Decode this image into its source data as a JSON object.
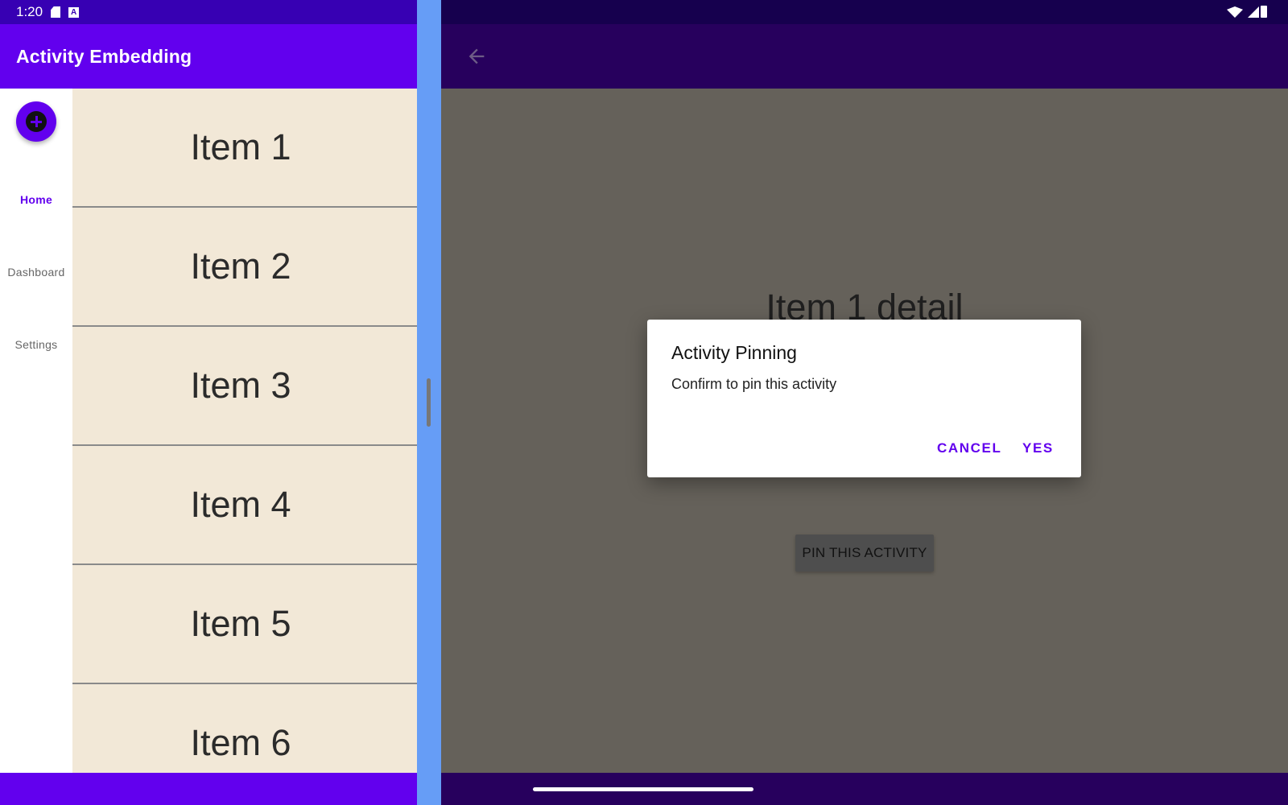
{
  "status_bar": {
    "time": "1:20"
  },
  "app": {
    "title": "Activity Embedding"
  },
  "nav_rail": {
    "items": [
      {
        "label": "Home",
        "active": true
      },
      {
        "label": "Dashboard",
        "active": false
      },
      {
        "label": "Settings",
        "active": false
      }
    ]
  },
  "list": {
    "items": [
      "Item 1",
      "Item 2",
      "Item 3",
      "Item 4",
      "Item 5",
      "Item 6"
    ]
  },
  "detail": {
    "title": "Item 1 detail",
    "pin_button_label": "PIN THIS ACTIVITY"
  },
  "dialog": {
    "title": "Activity Pinning",
    "message": "Confirm to pin this activity",
    "cancel_label": "CANCEL",
    "confirm_label": "YES"
  },
  "icons": {
    "fab": "add-circle-icon",
    "back": "arrow-back-icon",
    "sd_card": "sd-card-icon",
    "accessibility": "a-icon",
    "wifi": "wifi-icon",
    "signal": "signal-icon",
    "battery": "battery-icon"
  },
  "colors": {
    "primary": "#6200ee",
    "primary_dark": "#3700b3",
    "list_background": "#f2e8d7",
    "divider": "#669df6",
    "scrim_background": "#65615a"
  }
}
